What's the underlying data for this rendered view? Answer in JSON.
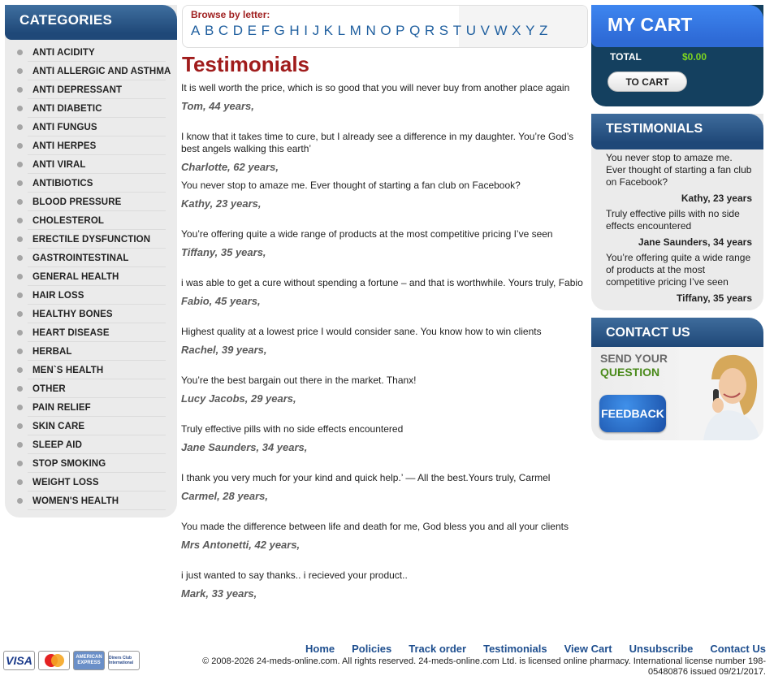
{
  "categories": {
    "title": "CATEGORIES",
    "items": [
      "ANTI ACIDITY",
      "ANTI ALLERGIC AND ASTHMA",
      "ANTI DEPRESSANT",
      "ANTI DIABETIC",
      "ANTI FUNGUS",
      "ANTI HERPES",
      "ANTI VIRAL",
      "ANTIBIOTICS",
      "BLOOD PRESSURE",
      "CHOLESTEROL",
      "ERECTILE DYSFUNCTION",
      "GASTROINTESTINAL",
      "GENERAL HEALTH",
      "HAIR LOSS",
      "HEALTHY BONES",
      "HEART DISEASE",
      "HERBAL",
      "MEN`S HEALTH",
      "OTHER",
      "PAIN RELIEF",
      "SKIN CARE",
      "SLEEP AID",
      "STOP SMOKING",
      "WEIGHT LOSS",
      "WOMEN'S HEALTH"
    ]
  },
  "browse": {
    "title": "Browse by letter:",
    "letters": [
      "A",
      "B",
      "C",
      "D",
      "E",
      "F",
      "G",
      "H",
      "I",
      "J",
      "K",
      "L",
      "M",
      "N",
      "O",
      "P",
      "Q",
      "R",
      "S",
      "T",
      "U",
      "V",
      "W",
      "X",
      "Y",
      "Z"
    ]
  },
  "page_title": "Testimonials",
  "testimonials": [
    {
      "text": "It is well worth the price, which is so good that you will never buy from another place again",
      "author": "Tom, 44 years,"
    },
    {
      "text": "I know that it takes time to cure, but I already see a difference in my daughter. You’re God’s best angels walking this earth’",
      "author": "Charlotte, 62 years,"
    },
    {
      "text": "You never stop to amaze me. Ever thought of starting a fan club on Facebook?",
      "author": "Kathy, 23 years,"
    },
    {
      "text": "You’re offering quite a wide range of products at the most competitive pricing I’ve seen",
      "author": "Tiffany, 35 years,"
    },
    {
      "text": "i was able to get a cure without spending a fortune – and that is worthwhile. Yours truly, Fabio",
      "author": "Fabio, 45 years,"
    },
    {
      "text": "Highest quality at a lowest price I would consider sane. You know how to win clients",
      "author": "Rachel, 39 years,"
    },
    {
      "text": "You’re the best bargain out there in the market. Thanx!",
      "author": "Lucy Jacobs, 29 years,"
    },
    {
      "text": "Truly effective pills with no side effects encountered",
      "author": "Jane Saunders, 34 years,"
    },
    {
      "text": "I thank you very much for your kind and quick help.’ — All the best.Yours truly, Carmel",
      "author": "Carmel, 28 years,"
    },
    {
      "text": "You made the difference between life and death for me, God bless you and all your clients",
      "author": "Mrs Antonetti, 42 years,"
    },
    {
      "text": "i just wanted to say thanks.. i recieved your product..",
      "author": "Mark, 33 years,"
    }
  ],
  "cart": {
    "title": "MY CART",
    "total_label": "TOTAL",
    "total_value": "$0.00",
    "button": "TO CART"
  },
  "side_testimonials": {
    "title": "TESTIMONIALS",
    "items": [
      {
        "text": "You never stop to amaze me. Ever thought of starting a fan club on Facebook?",
        "author": "Kathy, 23 years"
      },
      {
        "text": "Truly effective pills with no side effects encountered",
        "author": "Jane Saunders, 34 years"
      },
      {
        "text": "You’re offering quite a wide range of products at the most competitive pricing I’ve seen",
        "author": "Tiffany, 35 years"
      }
    ]
  },
  "contact": {
    "title": "CONTACT US",
    "line1": "SEND YOUR",
    "line2": "QUESTION",
    "button": "FEEDBACK"
  },
  "footer": {
    "links": [
      "Home",
      "Policies",
      "Track order",
      "Testimonials",
      "View Cart",
      "Unsubscribe",
      "Contact Us"
    ],
    "copyright": "© 2008-2026 24-meds-online.com. All rights reserved. 24-meds-online.com Ltd. is licensed online pharmacy. International license number 198-05480876 issued 09/21/2017.",
    "cards": {
      "visa": "VISA",
      "amex": "AMERICAN EXPRESS",
      "diners": "Diners Club International"
    }
  },
  "colors": {
    "header_blue": "#1f4878",
    "cart_blue": "#2e6ad6",
    "title_red": "#a01c1c",
    "link_blue": "#1f5f9f",
    "total_green": "#7dd420"
  }
}
